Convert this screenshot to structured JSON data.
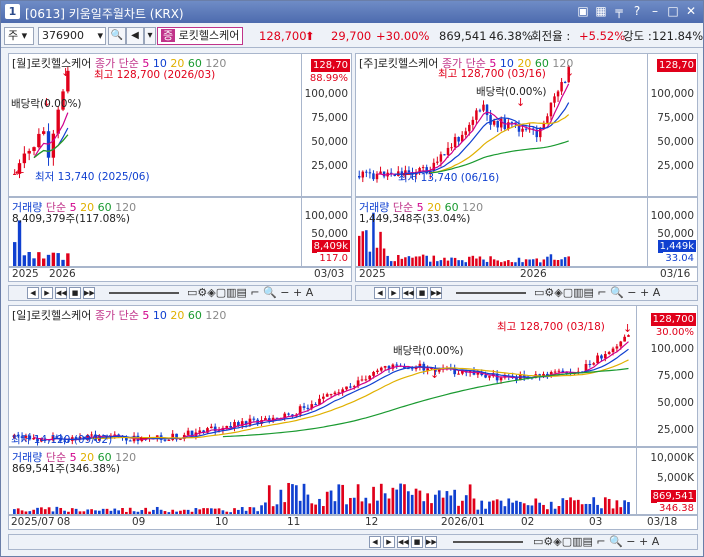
{
  "window": {
    "num": "1",
    "title": "[0613] 키움일주월차트 (KRX)"
  },
  "toolbar": {
    "market": "주",
    "code": "376900",
    "stock_badge": "증",
    "stock_name": "로킷헬스케어",
    "price": "128,700",
    "change": "29,700",
    "change_pct": "+30.00%",
    "volume": "869,541",
    "vol_ratio": "46.38%",
    "turnover_label": "회전율 :",
    "turnover": "+5.52%",
    "strength_label": "강도 :",
    "strength": "121.84%"
  },
  "monthly": {
    "title": "[월]로킷헬스케어",
    "ma_label": "종가 단순",
    "ma": [
      "5",
      "10",
      "20",
      "60",
      "120"
    ],
    "high_label": "최고 128,700 (2026/03)",
    "low_label": "최저 13,740 (2025/06)",
    "div_label": "배당락(0.00%)",
    "y_ticks": [
      "100,000",
      "75,000",
      "50,000",
      "25,000"
    ],
    "price_tag": "128,70",
    "pct_tag": "88.99%",
    "vol_title": "거래량",
    "vol_ma_label": "단순",
    "vol_ma": [
      "5",
      "20",
      "60",
      "120"
    ],
    "vol_value": "8,409,379주(117.08%)",
    "vol_tags": [
      "8,409k",
      "117.0"
    ],
    "vol_ticks": [
      "100,000",
      "50,000"
    ],
    "dates": [
      "2025",
      "2026"
    ],
    "axis_date": "03/03"
  },
  "weekly": {
    "title": "[주]로킷헬스케어",
    "ma_label": "종가 단순",
    "ma": [
      "5",
      "10",
      "20",
      "60",
      "120"
    ],
    "high_label": "최고 128,700 (03/16)",
    "low_label": "최저 13,740 (06/16)",
    "div_label": "배당락(0.00%)",
    "y_ticks": [
      "100,000",
      "75,000",
      "50,000",
      "25,000"
    ],
    "price_tag": "128,70",
    "vol_title": "거래량",
    "vol_ma_label": "단순",
    "vol_ma": [
      "5",
      "20",
      "60",
      "120"
    ],
    "vol_value": "1,449,348주(33.04%)",
    "vol_tags": [
      "1,449k",
      "33.04"
    ],
    "vol_ticks": [
      "100,000",
      "50,000"
    ],
    "dates": [
      "2025",
      "2026"
    ],
    "axis_date": "03/16"
  },
  "daily": {
    "title": "[일]로킷헬스케어",
    "ma_label": "종가 단순",
    "ma": [
      "5",
      "10",
      "20",
      "60",
      "120"
    ],
    "high_label": "최고 128,700 (03/18)",
    "low_label": "최저 14,120 (09/02)",
    "div_label": "배당락(0.00%)",
    "y_ticks": [
      "100,000",
      "75,000",
      "50,000",
      "25,000"
    ],
    "price_tag": "128,700",
    "pct_tag": "30.00%",
    "vol_title": "거래량",
    "vol_ma_label": "단순",
    "vol_ma": [
      "5",
      "20",
      "60",
      "120"
    ],
    "vol_value": "869,541주(346.38%)",
    "vol_tags": [
      "869,541",
      "346.38"
    ],
    "vol_ticks": [
      "10,000K",
      "5,000K"
    ],
    "dates": [
      "2025/07",
      "08",
      "09",
      "10",
      "11",
      "12",
      "2026/01",
      "02",
      "03"
    ],
    "axis_date": "03/18"
  },
  "colors": {
    "up": "#e0001a",
    "down": "#1040d0",
    "ma5": "#d0008c",
    "ma10": "#1040d0",
    "ma20": "#e0b000",
    "ma60": "#1a9a30",
    "ma120": "#8a8a8a"
  }
}
